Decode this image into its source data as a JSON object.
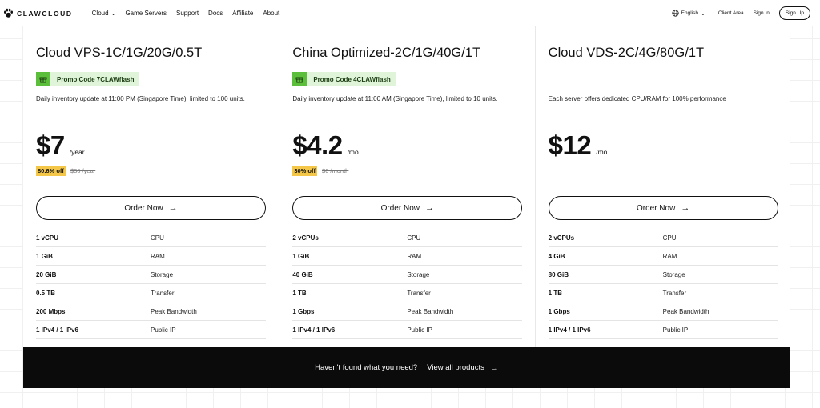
{
  "nav": {
    "brand": "CLAWCLOUD",
    "links": [
      {
        "label": "Cloud",
        "dropdown": true
      },
      {
        "label": "Game Servers",
        "dropdown": false
      },
      {
        "label": "Support",
        "dropdown": false
      },
      {
        "label": "Docs",
        "dropdown": false
      },
      {
        "label": "Affiliate",
        "dropdown": false
      },
      {
        "label": "About",
        "dropdown": false
      }
    ],
    "language": "English",
    "client_area": "Client Area",
    "sign_in": "Sign In",
    "sign_up": "Sign Up"
  },
  "plans": [
    {
      "title": "Cloud VPS-1C/1G/20G/0.5T",
      "promo": "Promo Code 7CLAWflash",
      "description": "Daily inventory update at 11:00 PM (Singapore Time), limited to 100 units.",
      "price": "$7",
      "period": "/year",
      "discount": "80.6% off",
      "original_price": "$36 /year",
      "order_label": "Order Now",
      "specs": [
        {
          "value": "1 vCPU",
          "label": "CPU"
        },
        {
          "value": "1 GiB",
          "label": "RAM"
        },
        {
          "value": "20 GiB",
          "label": "Storage"
        },
        {
          "value": "0.5 TB",
          "label": "Transfer"
        },
        {
          "value": "200 Mbps",
          "label": "Peak Bandwidth"
        },
        {
          "value": "1 IPv4 / 1 IPv6",
          "label": "Public IP"
        }
      ]
    },
    {
      "title": "China Optimized-2C/1G/40G/1T",
      "promo": "Promo Code 4CLAWflash",
      "description": "Daily inventory update at 11:00 AM (Singapore Time), limited to 10 units.",
      "price": "$4.2",
      "period": "/mo",
      "discount": "30% off",
      "original_price": "$6 /month",
      "order_label": "Order Now",
      "specs": [
        {
          "value": "2 vCPUs",
          "label": "CPU"
        },
        {
          "value": "1 GiB",
          "label": "RAM"
        },
        {
          "value": "40 GiB",
          "label": "Storage"
        },
        {
          "value": "1 TB",
          "label": "Transfer"
        },
        {
          "value": "1 Gbps",
          "label": "Peak Bandwidth"
        },
        {
          "value": "1 IPv4 / 1 IPv6",
          "label": "Public IP"
        }
      ]
    },
    {
      "title": "Cloud VDS-2C/4G/80G/1T",
      "description": "Each server offers dedicated CPU/RAM for 100% performance",
      "price": "$12",
      "period": "/mo",
      "order_label": "Order Now",
      "specs": [
        {
          "value": "2 vCPUs",
          "label": "CPU"
        },
        {
          "value": "4 GiB",
          "label": "RAM"
        },
        {
          "value": "80 GiB",
          "label": "Storage"
        },
        {
          "value": "1 TB",
          "label": "Transfer"
        },
        {
          "value": "1 Gbps",
          "label": "Peak Bandwidth"
        },
        {
          "value": "1 IPv4 / 1 IPv6",
          "label": "Public IP"
        }
      ]
    }
  ],
  "banner": {
    "question": "Haven't found what you need?",
    "link": "View all products"
  },
  "colors": {
    "promo_bg": "#dff4d8",
    "promo_icon": "#5bbf3b",
    "discount_bg": "#f5c748",
    "banner_bg": "#0b0b0b"
  }
}
